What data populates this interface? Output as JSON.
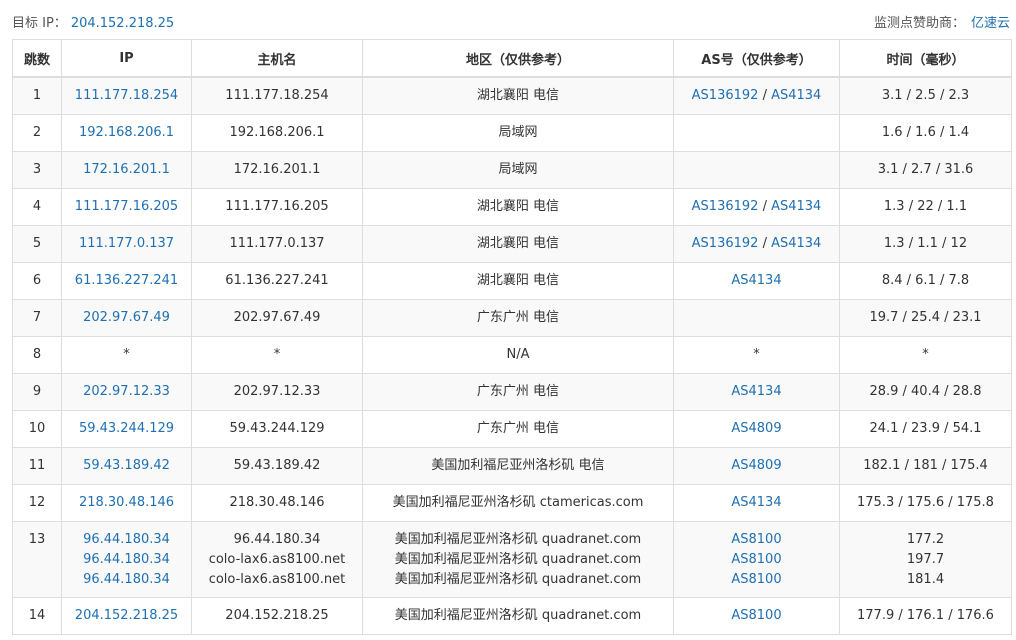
{
  "header": {
    "target_label": "目标 IP：",
    "target_ip": "204.152.218.25",
    "sponsor_label": "监测点赞助商：",
    "sponsor_name": "亿速云"
  },
  "table": {
    "columns": [
      "跳数",
      "IP",
      "主机名",
      "地区（仅供参考）",
      "AS号（仅供参考）",
      "时间（毫秒）"
    ],
    "rows": [
      {
        "hop": "1",
        "ips": [
          "111.177.18.254"
        ],
        "hosts": [
          "111.177.18.254"
        ],
        "regions": [
          "湖北襄阳 电信"
        ],
        "as": [
          [
            "AS136192",
            "AS4134"
          ]
        ],
        "times": [
          "3.1 / 2.5 / 2.3"
        ]
      },
      {
        "hop": "2",
        "ips": [
          "192.168.206.1"
        ],
        "hosts": [
          "192.168.206.1"
        ],
        "regions": [
          "局域网"
        ],
        "as": [
          []
        ],
        "times": [
          "1.6 / 1.6 / 1.4"
        ]
      },
      {
        "hop": "3",
        "ips": [
          "172.16.201.1"
        ],
        "hosts": [
          "172.16.201.1"
        ],
        "regions": [
          "局域网"
        ],
        "as": [
          []
        ],
        "times": [
          "3.1 / 2.7 / 31.6"
        ]
      },
      {
        "hop": "4",
        "ips": [
          "111.177.16.205"
        ],
        "hosts": [
          "111.177.16.205"
        ],
        "regions": [
          "湖北襄阳 电信"
        ],
        "as": [
          [
            "AS136192",
            "AS4134"
          ]
        ],
        "times": [
          "1.3 / 22 / 1.1"
        ]
      },
      {
        "hop": "5",
        "ips": [
          "111.177.0.137"
        ],
        "hosts": [
          "111.177.0.137"
        ],
        "regions": [
          "湖北襄阳 电信"
        ],
        "as": [
          [
            "AS136192",
            "AS4134"
          ]
        ],
        "times": [
          "1.3 / 1.1 / 12"
        ]
      },
      {
        "hop": "6",
        "ips": [
          "61.136.227.241"
        ],
        "hosts": [
          "61.136.227.241"
        ],
        "regions": [
          "湖北襄阳 电信"
        ],
        "as": [
          [
            "AS4134"
          ]
        ],
        "times": [
          "8.4 / 6.1 / 7.8"
        ]
      },
      {
        "hop": "7",
        "ips": [
          "202.97.67.49"
        ],
        "hosts": [
          "202.97.67.49"
        ],
        "regions": [
          "广东广州 电信"
        ],
        "as": [
          []
        ],
        "times": [
          "19.7 / 25.4 / 23.1"
        ]
      },
      {
        "hop": "8",
        "ips": [
          "*"
        ],
        "ip_plain": true,
        "hosts": [
          "*"
        ],
        "regions": [
          "N/A"
        ],
        "as_plain": "*",
        "as": [
          []
        ],
        "times": [
          "*"
        ]
      },
      {
        "hop": "9",
        "ips": [
          "202.97.12.33"
        ],
        "hosts": [
          "202.97.12.33"
        ],
        "regions": [
          "广东广州 电信"
        ],
        "as": [
          [
            "AS4134"
          ]
        ],
        "times": [
          "28.9 / 40.4 / 28.8"
        ]
      },
      {
        "hop": "10",
        "ips": [
          "59.43.244.129"
        ],
        "hosts": [
          "59.43.244.129"
        ],
        "regions": [
          "广东广州 电信"
        ],
        "as": [
          [
            "AS4809"
          ]
        ],
        "times": [
          "24.1 / 23.9 / 54.1"
        ]
      },
      {
        "hop": "11",
        "ips": [
          "59.43.189.42"
        ],
        "hosts": [
          "59.43.189.42"
        ],
        "regions": [
          "美国加利福尼亚州洛杉矶 电信"
        ],
        "as": [
          [
            "AS4809"
          ]
        ],
        "times": [
          "182.1 / 181 / 175.4"
        ]
      },
      {
        "hop": "12",
        "ips": [
          "218.30.48.146"
        ],
        "hosts": [
          "218.30.48.146"
        ],
        "regions": [
          "美国加利福尼亚州洛杉矶 ctamericas.com"
        ],
        "as": [
          [
            "AS4134"
          ]
        ],
        "times": [
          "175.3 / 175.6 / 175.8"
        ]
      },
      {
        "hop": "13",
        "ips": [
          "96.44.180.34",
          "96.44.180.34",
          "96.44.180.34"
        ],
        "hosts": [
          "96.44.180.34",
          "colo-lax6.as8100.net",
          "colo-lax6.as8100.net"
        ],
        "regions": [
          "美国加利福尼亚州洛杉矶 quadranet.com",
          "美国加利福尼亚州洛杉矶 quadranet.com",
          "美国加利福尼亚州洛杉矶 quadranet.com"
        ],
        "as": [
          [
            "AS8100"
          ],
          [
            "AS8100"
          ],
          [
            "AS8100"
          ]
        ],
        "times": [
          "177.2",
          "197.7",
          "181.4"
        ]
      },
      {
        "hop": "14",
        "ips": [
          "204.152.218.25"
        ],
        "hosts": [
          "204.152.218.25"
        ],
        "regions": [
          "美国加利福尼亚州洛杉矶 quadranet.com"
        ],
        "as": [
          [
            "AS8100"
          ]
        ],
        "times": [
          "177.9 / 176.1 / 176.6"
        ]
      }
    ]
  },
  "colors": {
    "link": "#1f6fb2",
    "border": "#dddddd",
    "stripe": "#f9f9f9",
    "text": "#333333"
  }
}
